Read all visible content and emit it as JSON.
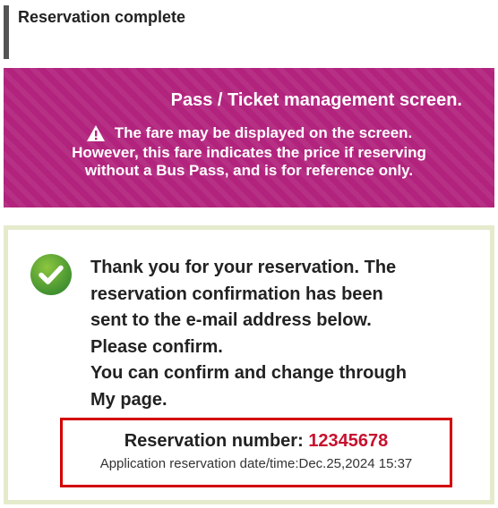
{
  "header": {
    "title": "Reservation complete"
  },
  "notice": {
    "title": "Pass / Ticket management screen.",
    "warning_line": "The fare may be displayed on the screen.",
    "line2": "However, this fare indicates the price if reserving",
    "line3": "without a Bus Pass, and is for reference only.",
    "icon": "warning-icon",
    "background_color": "#b2237d"
  },
  "confirmation": {
    "icon": "check-circle-icon",
    "lines": [
      "Thank you for your reservation. The",
      "reservation confirmation has been",
      "sent to the e-mail address below.",
      "Please confirm.",
      "You can confirm and change through",
      "My page."
    ],
    "reservation_number_label": "Reservation number:",
    "reservation_number": "12345678",
    "application_label": "Application reservation date/time:",
    "application_datetime": "Dec.25,2024 15:37",
    "accent_color": "#c8102e",
    "box_border_color": "#d40000"
  }
}
